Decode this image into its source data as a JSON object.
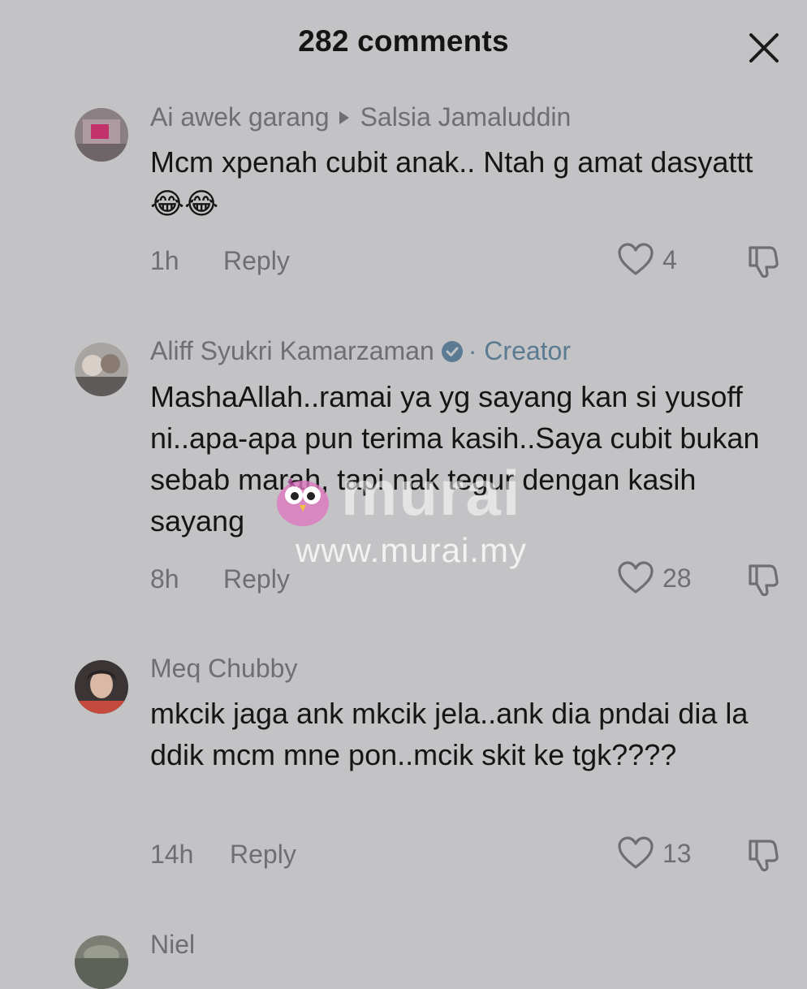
{
  "header": {
    "title": "282 comments",
    "close_icon": "close-icon"
  },
  "comments": [
    {
      "author": "Ai awek garang",
      "reply_to": "Salsia Jamaluddin",
      "text": "Mcm xpenah cubit anak.. Ntah g amat dasyattt😂😂",
      "time": "1h",
      "reply_label": "Reply",
      "likes": "4"
    },
    {
      "author": "Aliff Syukri Kamarzaman",
      "badge": "· Creator",
      "text": "MashaAllah..ramai ya yg sayang kan si yusoff ni..apa-apa pun terima kasih..Saya cubit bukan sebab marah, tapi nak tegur dengan kasih sayang",
      "time": "8h",
      "reply_label": "Reply",
      "likes": "28"
    },
    {
      "author": "Meq Chubby",
      "text": "mkcik jaga ank mkcik jela..ank dia pndai dia la ddik mcm mne pon..mcik skit ke tgk????",
      "time": "14h",
      "reply_label": "Reply",
      "likes": "13"
    },
    {
      "author": "Niel"
    }
  ],
  "watermark": {
    "logo": "murai",
    "url": "www.murai.my"
  },
  "colors": {
    "background": "#c3c3c5",
    "text_primary": "#151515",
    "text_secondary": "#6f6f73",
    "creator_accent": "#5a7b92"
  }
}
